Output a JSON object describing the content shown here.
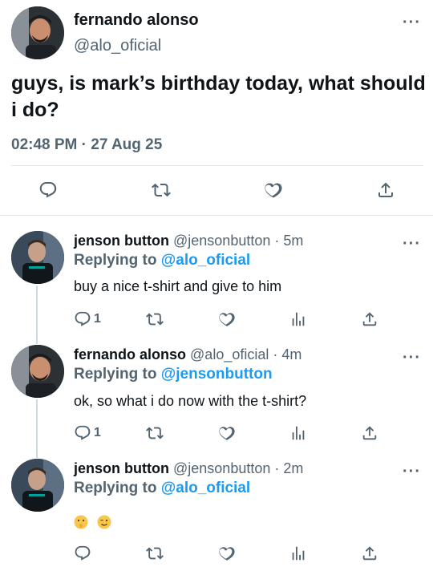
{
  "main_tweet": {
    "author_name": "fernando alonso",
    "author_handle": "@alo_oficial",
    "text": "guys, is mark’s birthday today, what should i do?",
    "timestamp": "02:48 PM · 27 Aug 25",
    "more_label": "···"
  },
  "replies": [
    {
      "author_name": "jenson button",
      "author_handle": "@jensonbutton · 5m",
      "replying_prefix": "Replying to",
      "replying_to": "@alo_oficial",
      "text": "buy a nice t-shirt and give to him",
      "reply_count": "1",
      "more_label": "···"
    },
    {
      "author_name": "fernando alonso",
      "author_handle": "@alo_oficial · 4m",
      "replying_prefix": "Replying to",
      "replying_to": "@jensonbutton",
      "text": "ok, so what i do now with the t-shirt?",
      "reply_count": "1",
      "more_label": "···"
    },
    {
      "author_name": "jenson button",
      "author_handle": "@jensonbutton · 2m",
      "replying_prefix": "Replying to",
      "replying_to": "@alo_oficial",
      "emojis": [
        "shushing-face-emoji",
        "winking-face-emoji"
      ],
      "reply_count": "",
      "more_label": "···"
    }
  ],
  "icons": {
    "reply": "reply-icon",
    "retweet": "retweet-icon",
    "like": "heart-icon",
    "analytics": "analytics-icon",
    "share": "share-icon"
  },
  "colors": {
    "accent": "#1d9bf0",
    "secondary_text": "#536471",
    "divider": "#e1e6ea"
  }
}
